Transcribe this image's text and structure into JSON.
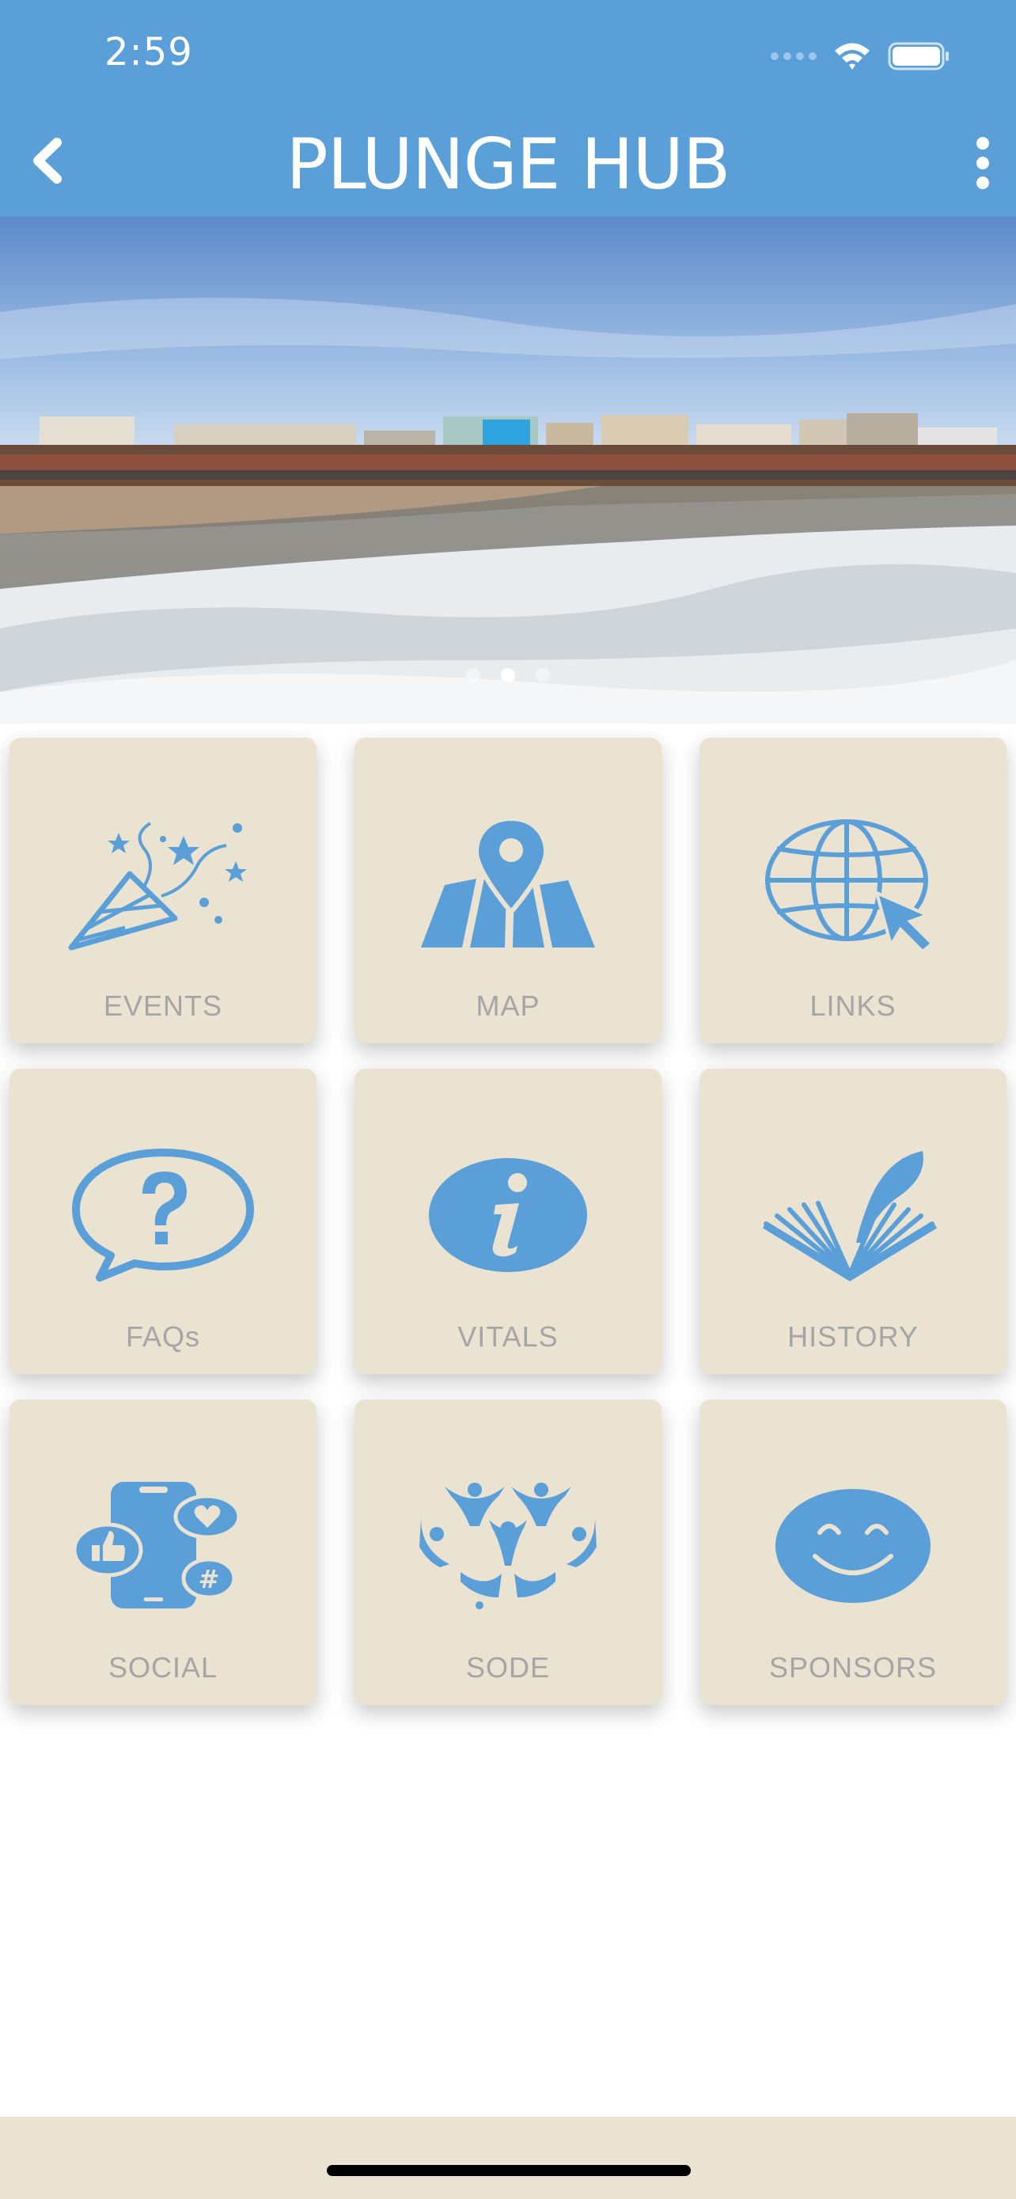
{
  "status_bar": {
    "time": "2:59"
  },
  "header": {
    "title": "PLUNGE HUB"
  },
  "carousel": {
    "slide_count": 3,
    "active_index": 1
  },
  "tiles": [
    {
      "label": "EVENTS",
      "icon": "party-popper-icon"
    },
    {
      "label": "MAP",
      "icon": "map-pin-icon"
    },
    {
      "label": "LINKS",
      "icon": "globe-cursor-icon"
    },
    {
      "label": "FAQs",
      "icon": "question-bubble-icon"
    },
    {
      "label": "VITALS",
      "icon": "info-icon"
    },
    {
      "label": "HISTORY",
      "icon": "book-quill-icon"
    },
    {
      "label": "SOCIAL",
      "icon": "social-phone-icon"
    },
    {
      "label": "SODE",
      "icon": "special-olympics-logo-icon"
    },
    {
      "label": "SPONSORS",
      "icon": "smiley-icon"
    }
  ],
  "colors": {
    "header": "#5b9fd8",
    "icon": "#5b9fd8",
    "tile": "#ebe3d1",
    "tile_label": "#a5a5a5"
  }
}
